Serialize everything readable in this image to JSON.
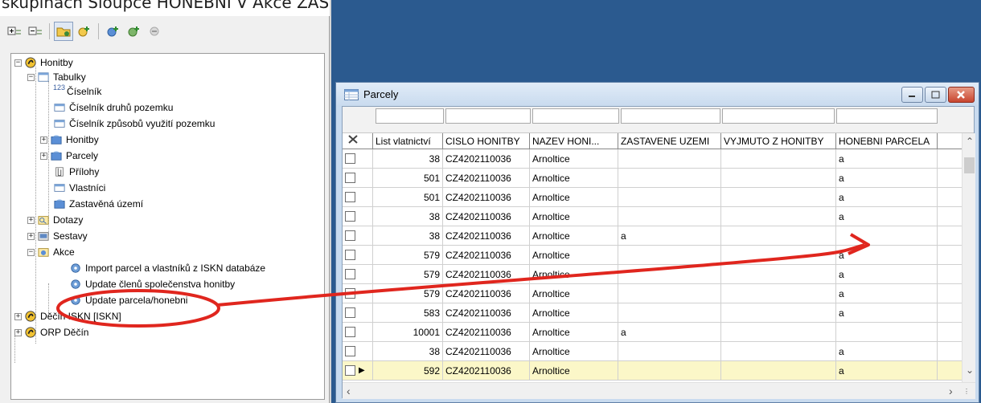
{
  "caption": {
    "text": "skupinách Sloupce HONEBNI V Akce ZAS budou Update parcela/honebni"
  },
  "toolbar": {
    "icons": [
      "expand-all-icon",
      "collapse-all-icon",
      "folder-icon",
      "add-icon",
      "add-child-icon",
      "add-star-icon",
      "disabled-icon"
    ]
  },
  "tree": {
    "honitby": "Honitby",
    "tabulky": "Tabulky",
    "ciselnik": "Číselník",
    "ciselnik_druhu": "Číselník druhů pozemku",
    "ciselnik_zpusobu": "Číselník způsobů využití pozemku",
    "honitby_child": "Honitby",
    "parcely": "Parcely",
    "prilohy": "Přílohy",
    "vlastnici": "Vlastníci",
    "zastavena": "Zastavěná území",
    "dotazy": "Dotazy",
    "sestavy": "Sestavy",
    "akce": "Akce",
    "import": "Import parcel a vlastníků z ISKN databáze",
    "update_clenu": "Update členů společenstva honitby",
    "update_parcela": "Update parcela/honebni",
    "decin": "Děčín ISKN [ISKN]",
    "orp": "ORP Děčín",
    "num_prefix": "123"
  },
  "window": {
    "title": "Parcely",
    "columns": [
      "List vlatnictví",
      "CISLO HONITBY",
      "NAZEV HONI...",
      "ZASTAVENE UZEMI",
      "VYJMUTO Z HONITBY",
      "HONEBNI PARCELA"
    ],
    "rows": [
      {
        "lv": "38",
        "cislo": "CZ4202110036",
        "nazev": "Arnoltice",
        "zast": "",
        "vyj": "",
        "honebni": "a"
      },
      {
        "lv": "501",
        "cislo": "CZ4202110036",
        "nazev": "Arnoltice",
        "zast": "",
        "vyj": "",
        "honebni": "a"
      },
      {
        "lv": "501",
        "cislo": "CZ4202110036",
        "nazev": "Arnoltice",
        "zast": "",
        "vyj": "",
        "honebni": "a"
      },
      {
        "lv": "38",
        "cislo": "CZ4202110036",
        "nazev": "Arnoltice",
        "zast": "",
        "vyj": "",
        "honebni": "a"
      },
      {
        "lv": "38",
        "cislo": "CZ4202110036",
        "nazev": "Arnoltice",
        "zast": "a",
        "vyj": "",
        "honebni": ""
      },
      {
        "lv": "579",
        "cislo": "CZ4202110036",
        "nazev": "Arnoltice",
        "zast": "",
        "vyj": "",
        "honebni": "a"
      },
      {
        "lv": "579",
        "cislo": "CZ4202110036",
        "nazev": "Arnoltice",
        "zast": "",
        "vyj": "",
        "honebni": "a"
      },
      {
        "lv": "579",
        "cislo": "CZ4202110036",
        "nazev": "Arnoltice",
        "zast": "",
        "vyj": "",
        "honebni": "a"
      },
      {
        "lv": "583",
        "cislo": "CZ4202110036",
        "nazev": "Arnoltice",
        "zast": "",
        "vyj": "",
        "honebni": "a"
      },
      {
        "lv": "10001",
        "cislo": "CZ4202110036",
        "nazev": "Arnoltice",
        "zast": "a",
        "vyj": "",
        "honebni": ""
      },
      {
        "lv": "38",
        "cislo": "CZ4202110036",
        "nazev": "Arnoltice",
        "zast": "",
        "vyj": "",
        "honebni": "a"
      },
      {
        "lv": "592",
        "cislo": "CZ4202110036",
        "nazev": "Arnoltice",
        "zast": "",
        "vyj": "",
        "honebni": "a",
        "selected": true
      }
    ]
  },
  "annotation": {
    "color": "#e0261e"
  }
}
